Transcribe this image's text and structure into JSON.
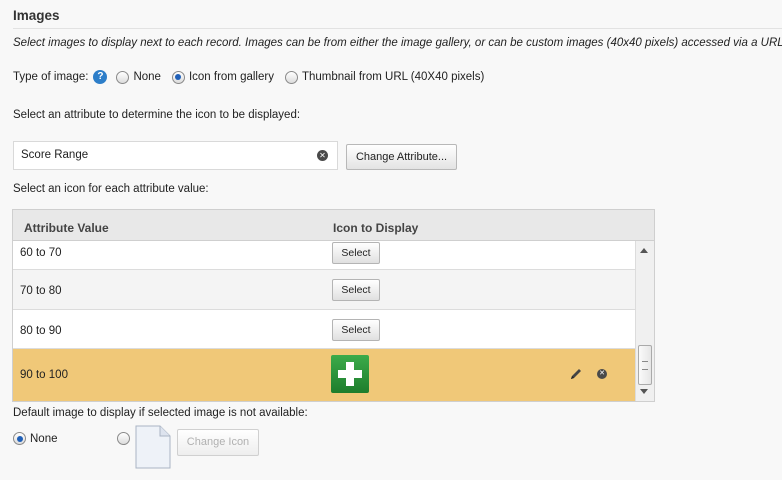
{
  "section": {
    "title": "Images",
    "description": "Select images to display next to each record. Images can be from either the image gallery, or can be custom images (40x40 pixels) accessed via a URL."
  },
  "image_type": {
    "label": "Type of image:",
    "options": [
      "None",
      "Icon from gallery",
      "Thumbnail from URL (40X40 pixels)"
    ],
    "selected": "Icon from gallery"
  },
  "attribute": {
    "prompt": "Select an attribute to determine the icon to be displayed:",
    "value": "Score Range",
    "change_button": "Change Attribute..."
  },
  "icon_grid": {
    "prompt": "Select an icon for each attribute value:",
    "headers": [
      "Attribute Value",
      "Icon to Display"
    ],
    "rows": [
      {
        "value": "60 to 70",
        "action": "Select"
      },
      {
        "value": "70 to 80",
        "action": "Select"
      },
      {
        "value": "80 to 90",
        "action": "Select"
      },
      {
        "value": "90 to 100",
        "icon": "green-plus-icon",
        "selected": true
      }
    ]
  },
  "default_image": {
    "prompt": "Default image to display if selected image is not available:",
    "options": [
      "None",
      "custom"
    ],
    "selected": "None",
    "change_button": "Change Icon"
  },
  "colors": {
    "selected_row": "#f0c878",
    "help_icon": "#2d7ec9",
    "plus_icon": "#2a9a3a"
  }
}
